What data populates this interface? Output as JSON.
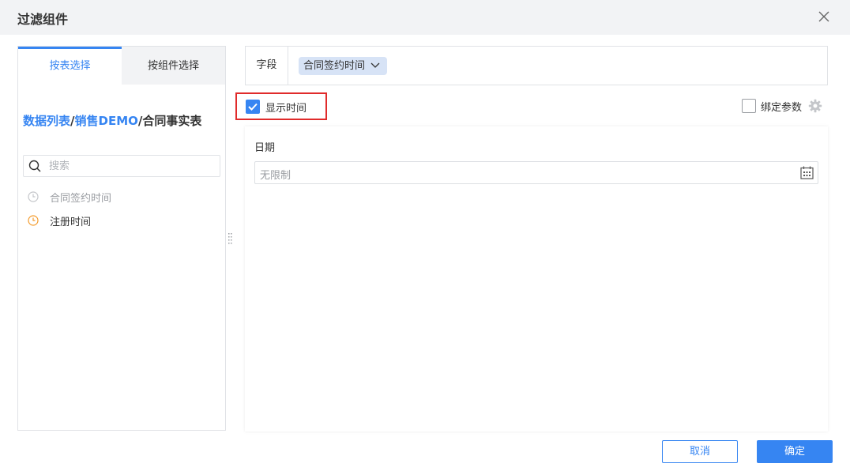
{
  "dialog": {
    "title": "过滤组件"
  },
  "left_panel": {
    "tabs": [
      {
        "label": "按表选择",
        "active": true
      },
      {
        "label": "按组件选择",
        "active": false
      }
    ],
    "breadcrumb": {
      "part1": "数据列表",
      "sep1": "/",
      "part2": "销售DEMO",
      "sep2": "/",
      "current": "合同事实表"
    },
    "search": {
      "placeholder": "搜索",
      "value": ""
    },
    "fields": [
      {
        "label": "合同签约时间",
        "icon": "clock-icon",
        "state": "disabled"
      },
      {
        "label": "注册时间",
        "icon": "clock-icon",
        "state": "enabled"
      }
    ]
  },
  "field_selector": {
    "label": "字段",
    "selected": "合同签约时间"
  },
  "options": {
    "show_time": {
      "label": "显示时间",
      "checked": true
    },
    "bind_param": {
      "label": "绑定参数",
      "checked": false
    }
  },
  "preview": {
    "label": "日期",
    "placeholder": "无限制"
  },
  "footer": {
    "cancel_label": "取消",
    "ok_label": "确定"
  },
  "colors": {
    "accent": "#3685f2",
    "highlight_border": "#e02b2b",
    "clock_active": "#f39c2f",
    "tag_bg": "#d7e3f6"
  }
}
